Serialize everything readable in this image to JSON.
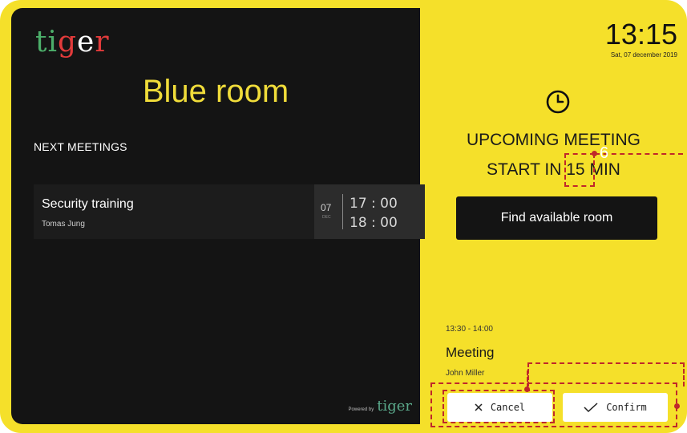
{
  "brand": {
    "logo_letters": [
      "t",
      "i",
      "g",
      "e",
      "r"
    ],
    "logo_colors": [
      "#4cae6a",
      "#4cae6a",
      "#e23b3b",
      "#ffffff",
      "#e23b3b"
    ],
    "accent": "#f5e02a",
    "powered_by": "Powered by",
    "powered_logo": "tiger"
  },
  "room": {
    "name": "Blue room",
    "next_heading": "NEXT MEETINGS"
  },
  "meetings": [
    {
      "title": "Security training",
      "organizer": "Tomas Jung",
      "day": "07",
      "month": "DEC",
      "start": "17 : 00",
      "end": "18 : 00"
    }
  ],
  "status": {
    "time": "13:15",
    "date": "Sat, 07 december 2019",
    "clock_icon": "clock-icon",
    "upcoming_label": "UPCOMING MEETING",
    "start_prefix": "START IN",
    "start_minutes": "15",
    "start_suffix": "MIN",
    "find_room_label": "Find available room"
  },
  "next_meeting": {
    "range": "13:30 - 14:00",
    "title": "Meeting",
    "organizer": "John Miller"
  },
  "actions": {
    "cancel_label": "Cancel",
    "cancel_icon": "close-icon",
    "confirm_label": "Confirm",
    "confirm_icon": "check-icon"
  },
  "annotations": {
    "marker_number": "6",
    "color": "#c0282a"
  }
}
